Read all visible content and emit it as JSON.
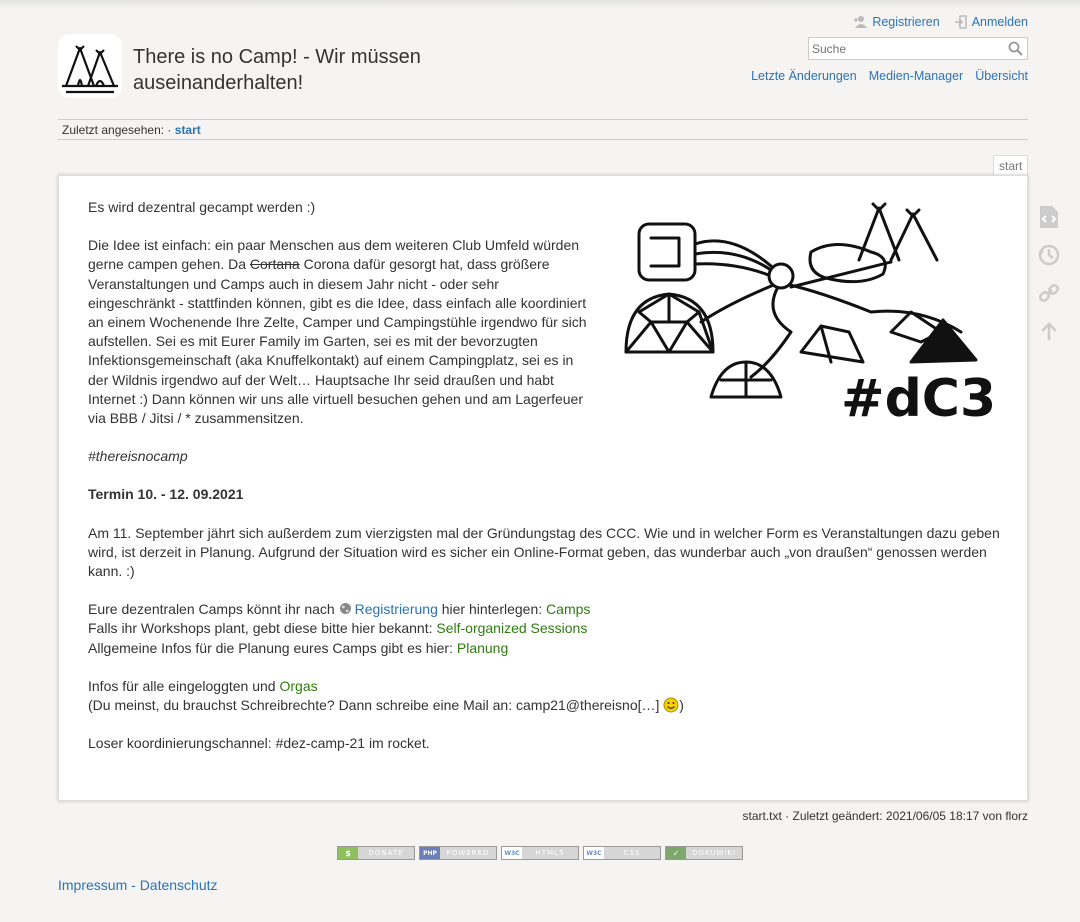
{
  "header": {
    "title_line1": "There is no Camp! - Wir müssen",
    "title_line2": "auseinanderhalten!",
    "register_label": "Registrieren",
    "login_label": "Anmelden",
    "search_placeholder": "Suche",
    "site_tools": [
      "Letzte Änderungen",
      "Medien-Manager",
      "Übersicht"
    ]
  },
  "breadcrumb": {
    "label": "Zuletzt angesehen:",
    "separator": "·",
    "item": "start"
  },
  "page_id": "start",
  "content": {
    "intro1": "Es wird dezentral gecampt werden :)",
    "p2_before": "Die Idee ist einfach: ein paar Menschen aus dem weiteren Club Umfeld würden gerne campen gehen. Da ",
    "p2_strike": "Cortana",
    "p2_after": " Corona dafür gesorgt hat, dass größere Veranstaltungen und Camps auch in diesem Jahr nicht - oder sehr eingeschränkt - stattfinden können, gibt es die Idee, dass einfach alle koordiniert an einem Wochenende Ihre Zelte, Camper und Campingstühle irgendwo für sich aufstellen. Sei es mit Eurer Family im Garten, sei es mit der bevorzugten Infektionsgemeinschaft (aka Knuffelkontakt) auf einem Campingplatz, sei es in der Wildnis irgendwo auf der Welt… Hauptsache Ihr seid draußen und habt Internet :) Dann können wir uns alle virtuell besuchen gehen und am Lagerfeuer via BBB / Jitsi / * zusammensitzen.",
    "hashtag": "#thereisnocamp",
    "termin": "Termin 10. - 12. 09.2021",
    "anniversary": "Am 11. September jährt sich außerdem zum vierzigsten mal der Gründungstag des CCC. Wie und in welcher Form es Veranstaltungen dazu geben wird, ist derzeit in Planung. Aufgrund der Situation wird es sicher ein Online-Format geben, das wunderbar auch „von draußen“ genossen werden kann. :)",
    "line_camps_before": "Eure dezentralen Camps könnt ihr nach ",
    "link_registrierung": "Registrierung",
    "line_camps_mid": " hier hinterlegen: ",
    "link_camps": "Camps",
    "line_workshops": "Falls ihr Workshops plant, gebt diese bitte hier bekannt: ",
    "link_sessions": "Self-organized Sessions",
    "line_planung": "Allgemeine Infos für die Planung eures Camps gibt es hier: ",
    "link_planung": "Planung",
    "line_infos": "Infos für alle eingeloggten und ",
    "link_orgas": "Orgas",
    "line_mail": "(Du meinst, du brauchst Schreibrechte? Dann schreibe eine Mail an: camp21@thereisno[…] ",
    "line_mail_end": ")",
    "channel": "Loser koordinierungschannel: #dez-camp-21 im rocket.",
    "illustration_text": "#dC3"
  },
  "docinfo": "start.txt · Zuletzt geändert: 2021/06/05 18:17 von florz",
  "badges": [
    {
      "mark": "$",
      "text": "DONATE",
      "color": "#8fbf5f"
    },
    {
      "mark": "PHP",
      "text": "POWERED",
      "color": "#6b7fb8"
    },
    {
      "mark": "W3C",
      "text": "HTML5",
      "color": "#6a8fbf"
    },
    {
      "mark": "W3C",
      "text": "CSS",
      "color": "#6a8fbf"
    },
    {
      "mark": "✓",
      "text": "DOKUWIKI",
      "color": "#7ea86b"
    }
  ],
  "footer": {
    "impressum": "Impressum",
    "separator": " - ",
    "datenschutz": "Datenschutz"
  },
  "colors": {
    "link": "#2b73b7",
    "internal_link": "#2e7d0f",
    "background": "#f5f4f2"
  }
}
